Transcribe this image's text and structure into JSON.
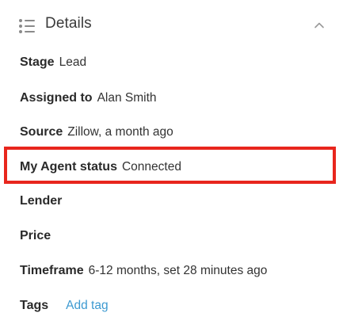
{
  "header": {
    "title": "Details",
    "icon": "list-icon",
    "collapse_icon": "chevron-up-icon"
  },
  "fields": [
    {
      "label": "Stage",
      "value": "Lead"
    },
    {
      "label": "Assigned to",
      "value": "Alan Smith"
    },
    {
      "label": "Source",
      "value": "Zillow, a month ago"
    },
    {
      "label": "My Agent status",
      "value": "Connected"
    },
    {
      "label": "Lender",
      "value": ""
    },
    {
      "label": "Price",
      "value": ""
    },
    {
      "label": "Timeframe",
      "value": "6-12 months, set 28 minutes ago"
    },
    {
      "label": "Tags",
      "link": "Add tag"
    }
  ],
  "colors": {
    "highlight": "#e8261d",
    "link": "#3d9ad1"
  }
}
